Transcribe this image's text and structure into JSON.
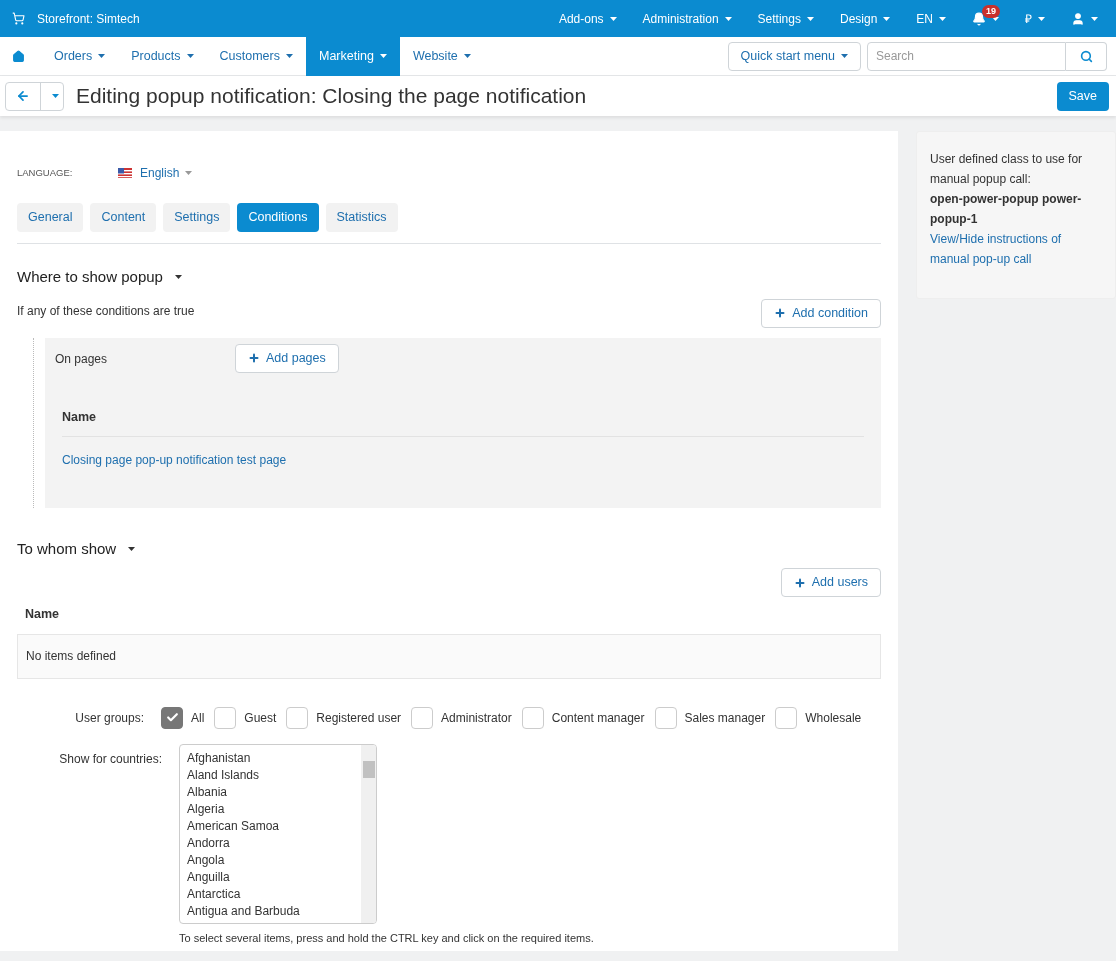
{
  "top_bar": {
    "store": "Storefront: Simtech",
    "menus": [
      "Add-ons",
      "Administration",
      "Settings",
      "Design",
      "EN"
    ],
    "notifications": "19",
    "currency": "₽"
  },
  "nav": {
    "items": [
      {
        "label": "Orders",
        "selected": false
      },
      {
        "label": "Products",
        "selected": false
      },
      {
        "label": "Customers",
        "selected": false
      },
      {
        "label": "Marketing",
        "selected": true
      },
      {
        "label": "Website",
        "selected": false
      }
    ],
    "quick_start": "Quick start menu",
    "search": {
      "placeholder": "Search"
    }
  },
  "header": {
    "title": "Editing popup notification: Closing the page notification",
    "save": "Save"
  },
  "language": {
    "label": "LANGUAGE:",
    "value": "English"
  },
  "tabs": [
    {
      "label": "General",
      "selected": false
    },
    {
      "label": "Content",
      "selected": false
    },
    {
      "label": "Settings",
      "selected": false
    },
    {
      "label": "Conditions",
      "selected": true
    },
    {
      "label": "Statistics",
      "selected": false
    }
  ],
  "where": {
    "title": "Where to show popup",
    "note": "If any of these conditions are true",
    "add_button": "Add condition",
    "condition": {
      "label": "On pages",
      "add_button": "Add pages",
      "columns": [
        "Name"
      ],
      "rows": [
        "Closing page pop-up notification test page"
      ]
    }
  },
  "whom": {
    "title": "To whom show",
    "add_button": "Add users",
    "columns": [
      "Name"
    ],
    "empty": "No items defined"
  },
  "user_groups": {
    "label": "User groups:",
    "options": [
      {
        "label": "All",
        "checked": true
      },
      {
        "label": "Guest",
        "checked": false
      },
      {
        "label": "Registered user",
        "checked": false
      },
      {
        "label": "Administrator",
        "checked": false
      },
      {
        "label": "Content manager",
        "checked": false
      },
      {
        "label": "Sales manager",
        "checked": false
      },
      {
        "label": "Wholesale",
        "checked": false
      }
    ]
  },
  "countries": {
    "label": "Show for countries:",
    "items": [
      "Afghanistan",
      "Aland Islands",
      "Albania",
      "Algeria",
      "American Samoa",
      "Andorra",
      "Angola",
      "Anguilla",
      "Antarctica",
      "Antigua and Barbuda"
    ],
    "hint": "To select several items, press and hold the CTRL key and click on the required items."
  },
  "sidebar": {
    "text": "User defined class to use for manual popup call:",
    "class_name": "open-power-popup power-popup-1",
    "link": "View/Hide instructions of manual pop-up call"
  }
}
